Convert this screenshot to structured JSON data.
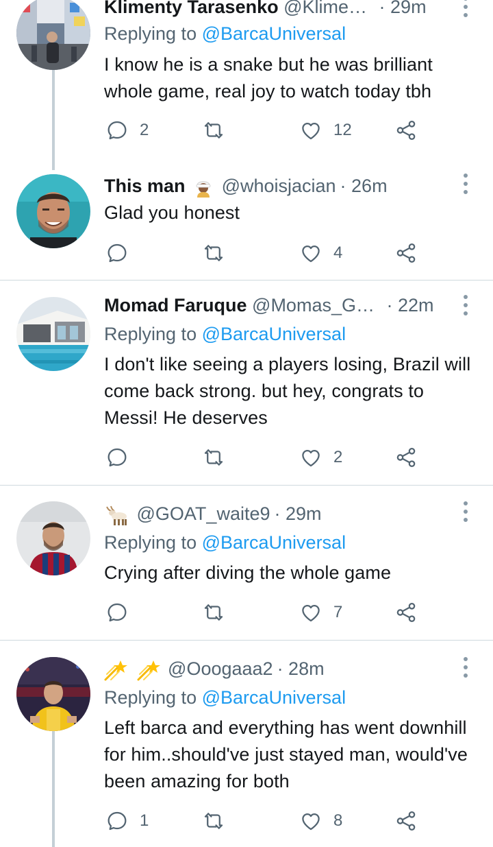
{
  "colors": {
    "text": "#14171a",
    "secondary": "#536471",
    "link": "#1d9bf0",
    "divider": "#cfd9de",
    "thread": "#c4cfd6"
  },
  "tweets": [
    {
      "name": "Klimenty Tarasenko",
      "handle": "@Klime…",
      "time": "· 29m",
      "reply_prefix": "Replying to ",
      "reply_to": "@BarcaUniversal",
      "text": "I know he is a snake but he was brilliant whole game, real joy to watch  today tbh",
      "replies": "2",
      "retweets": "",
      "likes": "12"
    },
    {
      "name": "This man",
      "name_emoji": "person-with-turban-emoji",
      "handle": "@whoisjacian",
      "time": "· 26m",
      "text": "Glad you honest",
      "replies": "",
      "retweets": "",
      "likes": "4"
    },
    {
      "name": "Momad Faruque",
      "handle": "@Momas_G…",
      "time": "· 22m",
      "reply_prefix": "Replying to ",
      "reply_to": "@BarcaUniversal",
      "text": "I don't like seeing a players losing, Brazil will come back strong. but hey, congrats to Messi! He deserves",
      "replies": "",
      "retweets": "",
      "likes": "2"
    },
    {
      "name_emoji": "goat-emoji",
      "handle": "@GOAT_waite9",
      "time": "· 29m",
      "reply_prefix": "Replying to ",
      "reply_to": "@BarcaUniversal",
      "text": "Crying after diving the whole game",
      "replies": "",
      "retweets": "",
      "likes": "7"
    },
    {
      "name_emoji": "shooting-star-emoji",
      "handle": "@Ooogaaa2",
      "time": "· 28m",
      "reply_prefix": "Replying to ",
      "reply_to": "@BarcaUniversal",
      "text": "Left barca and everything has went downhill for him..should've just stayed man, would've been amazing for both",
      "replies": "1",
      "retweets": "",
      "likes": "8"
    }
  ]
}
